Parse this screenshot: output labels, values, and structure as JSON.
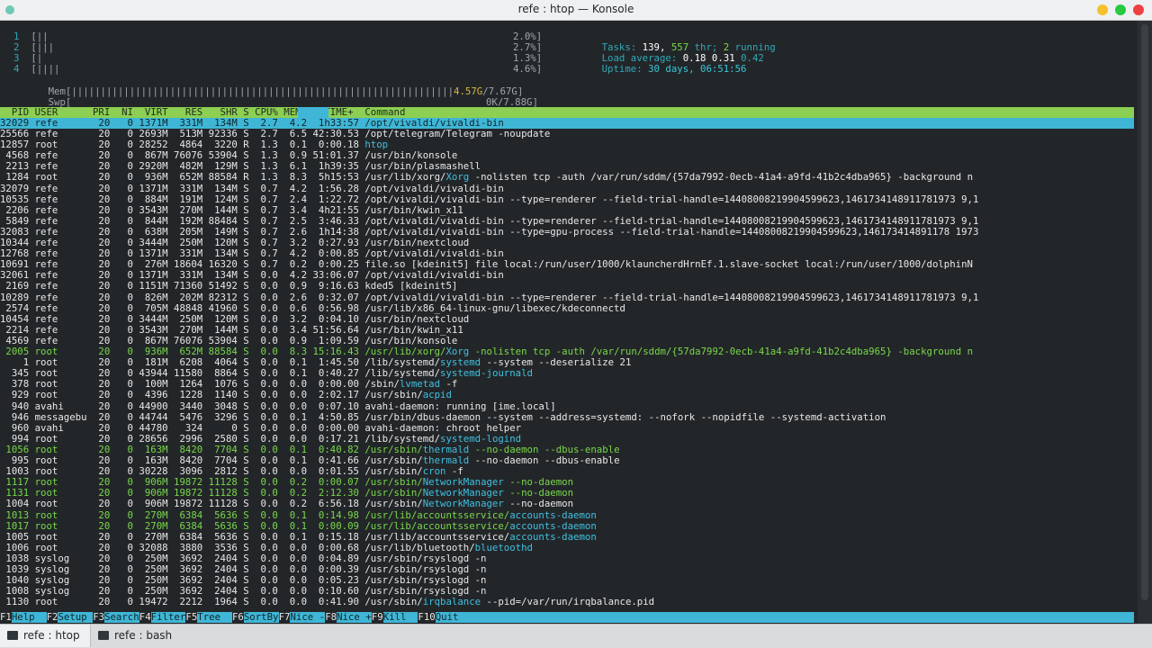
{
  "window": {
    "title": "refe : htop — Konsole",
    "buttons": {
      "minimize_color": "#f6c02c",
      "maximize_color": "#27c93f",
      "close_color": "#ee4040"
    }
  },
  "meters": {
    "cpu": [
      {
        "id": "1",
        "bar": "[||",
        "value": "2.0%]"
      },
      {
        "id": "2",
        "bar": "[|||",
        "value": "2.7%]"
      },
      {
        "id": "3",
        "bar": "[|",
        "value": "1.3%]"
      },
      {
        "id": "4",
        "bar": "[||||",
        "value": "4.6%]"
      }
    ],
    "mem": {
      "label": "Mem",
      "bar": "[||||||||||||||||||||||||||||||||||||||||||||||||||||||||||||||||||",
      "used": "4.57G",
      "total": "/7.67G]"
    },
    "swp": {
      "label": "Swp",
      "bar": "[",
      "value": "0K/7.88G]"
    }
  },
  "summary": {
    "tasks_label": "Tasks:",
    "tasks": "139,",
    "thr": "557",
    "thr_label": "thr;",
    "running": "2",
    "running_label": "running",
    "load_label": "Load average:",
    "load1": "0.18",
    "load5": "0.31",
    "load15": "0.42",
    "uptime_label": "Uptime:",
    "uptime": "30 days, 06:51:56"
  },
  "table": {
    "header": "  PID USER      PRI  NI  VIRT   RES   SHR S CPU% MEM%   TIME+  Command",
    "selected": "32029 refe       20   0 1371M  331M  134M S  2.7  4.2  1h33:57 /opt/vivaldi/vivaldi-bin",
    "rows": [
      {
        "c": "25566 refe       20   0 2693M  513M 92336 S  2.7  6.5 42:30.53 /opt/telegram/Telegram -noupdate"
      },
      {
        "c": "12857 root       20   0 28252  4864  3220 R  1.3  0.1  0:00.18 ",
        "hi": "htop"
      },
      {
        "c": " 4568 refe       20   0  867M 76076 53904 S  1.3  0.9 51:01.37 /usr/bin/konsole"
      },
      {
        "c": " 2213 refe       20   0 2920M  482M  129M S  1.3  6.1  1h39:35 /usr/bin/plasmashell"
      },
      {
        "c": " 1284 root       20   0  936M  652M 88584 R  1.3  8.3  5h15:53 /usr/lib/xorg/",
        "hi": "Xorg",
        "rest": " -nolisten tcp -auth /var/run/sddm/{57da7992-0ecb-41a4-a9fd-41b2c4dba965} -background n"
      },
      {
        "c": "32079 refe       20   0 1371M  331M  134M S  0.7  4.2  1:56.28 /opt/vivaldi/vivaldi-bin"
      },
      {
        "c": "10535 refe       20   0  884M  191M  124M S  0.7  2.4  1:22.72 /opt/vivaldi/vivaldi-bin --type=renderer --field-trial-handle=14408008219904599623,1461734148911781973 9,1"
      },
      {
        "c": " 2206 refe       20   0 3543M  270M  144M S  0.7  3.4  4h21:55 /usr/bin/kwin_x11"
      },
      {
        "c": " 5849 refe       20   0  844M  192M 88484 S  0.7  2.5  3:46.33 /opt/vivaldi/vivaldi-bin --type=renderer --field-trial-handle=14408008219904599623,1461734148911781973 9,1"
      },
      {
        "c": "32083 refe       20   0  638M  205M  149M S  0.7  2.6  1h14:38 /opt/vivaldi/vivaldi-bin --type=gpu-process --field-trial-handle=14408008219904599623,146173414891178 1973"
      },
      {
        "c": "10344 refe       20   0 3444M  250M  120M S  0.7  3.2  0:27.93 /usr/bin/nextcloud"
      },
      {
        "c": "12768 refe       20   0 1371M  331M  134M S  0.7  4.2  0:00.85 /opt/vivaldi/vivaldi-bin"
      },
      {
        "c": "10691 refe       20   0  276M 18604 16320 S  0.7  0.2  0:00.25 file.so [kdeinit5] file local:/run/user/1000/klauncherdHrnEf.1.slave-socket local:/run/user/1000/dolphinN"
      },
      {
        "c": "32061 refe       20   0 1371M  331M  134M S  0.0  4.2 33:06.07 /opt/vivaldi/vivaldi-bin"
      },
      {
        "c": " 2169 refe       20   0 1151M 71360 51492 S  0.0  0.9  9:16.63 kded5 [kdeinit5]"
      },
      {
        "c": "10289 refe       20   0  826M  202M 82312 S  0.0  2.6  0:32.07 /opt/vivaldi/vivaldi-bin --type=renderer --field-trial-handle=14408008219904599623,1461734148911781973 9,1"
      },
      {
        "c": " 2574 refe       20   0  705M 48848 41960 S  0.0  0.6  0:56.98 /usr/lib/x86_64-linux-gnu/libexec/kdeconnectd"
      },
      {
        "c": "10454 refe       20   0 3444M  250M  120M S  0.0  3.2  0:04.10 /usr/bin/nextcloud"
      },
      {
        "c": " 2214 refe       20   0 3543M  270M  144M S  0.0  3.4 51:56.64 /usr/bin/kwin_x11"
      },
      {
        "c": " 4569 refe       20   0  867M 76076 53904 S  0.0  0.9  1:09.59 /usr/bin/konsole"
      },
      {
        "c": " 2005 root       20   0  936M  652M 88584 S  0.0  8.3 15:16.43 /usr/lib/xorg/",
        "hi": "Xorg",
        "rest": " -nolisten tcp -auth /var/run/sddm/{57da7992-0ecb-41a4-a9fd-41b2c4dba965} -background n",
        "thread": true
      },
      {
        "c": "    1 root       20   0  181M  6208  4064 S  0.0  0.1  1:45.50 /lib/systemd/",
        "hi": "systemd",
        "rest": " --system --deserialize 21"
      },
      {
        "c": "  345 root       20   0 43944 11580  8864 S  0.0  0.1  0:40.27 /lib/systemd/",
        "hi": "systemd-journald"
      },
      {
        "c": "  378 root       20   0  100M  1264  1076 S  0.0  0.0  0:00.00 /sbin/",
        "hi": "lvmetad",
        "rest": " -f"
      },
      {
        "c": "  929 root       20   0  4396  1228  1140 S  0.0  0.0  2:02.17 /usr/sbin/",
        "hi": "acpid"
      },
      {
        "c": "  940 avahi      20   0 44900  3440  3048 S  0.0  0.0  0:07.10 avahi-daemon: running [ime.local]"
      },
      {
        "c": "  946 messagebu  20   0 44744  5476  3296 S  0.0  0.1  4:50.85 /usr/bin/dbus-daemon --system --address=systemd: --nofork --nopidfile --systemd-activation"
      },
      {
        "c": "  960 avahi      20   0 44780   324     0 S  0.0  0.0  0:00.00 avahi-daemon: chroot helper"
      },
      {
        "c": "  994 root       20   0 28656  2996  2580 S  0.0  0.0  0:17.21 /lib/systemd/",
        "hi": "systemd-logind"
      },
      {
        "c": " 1056 root       20   0  163M  8420  7704 S  0.0  0.1  0:40.82 /usr/sbin/",
        "hi": "thermald",
        "rest": " --no-daemon --dbus-enable",
        "thread": true
      },
      {
        "c": "  995 root       20   0  163M  8420  7704 S  0.0  0.1  0:41.66 /usr/sbin/",
        "hi": "thermald",
        "rest": " --no-daemon --dbus-enable"
      },
      {
        "c": " 1003 root       20   0 30228  3096  2812 S  0.0  0.0  0:01.55 /usr/sbin/",
        "hi": "cron",
        "rest": " -f"
      },
      {
        "c": " 1117 root       20   0  906M 19872 11128 S  0.0  0.2  0:00.07 /usr/sbin/",
        "hi": "NetworkManager",
        "rest": " --no-daemon",
        "thread": true
      },
      {
        "c": " 1131 root       20   0  906M 19872 11128 S  0.0  0.2  2:12.30 /usr/sbin/",
        "hi": "NetworkManager",
        "rest": " --no-daemon",
        "thread": true
      },
      {
        "c": " 1004 root       20   0  906M 19872 11128 S  0.0  0.2  6:56.18 /usr/sbin/",
        "hi": "NetworkManager",
        "rest": " --no-daemon"
      },
      {
        "c": " 1013 root       20   0  270M  6384  5636 S  0.0  0.1  0:14.98 /usr/lib/accountsservice/",
        "hi": "accounts-daemon",
        "thread": true
      },
      {
        "c": " 1017 root       20   0  270M  6384  5636 S  0.0  0.1  0:00.09 /usr/lib/accountsservice/",
        "hi": "accounts-daemon",
        "thread": true
      },
      {
        "c": " 1005 root       20   0  270M  6384  5636 S  0.0  0.1  0:15.18 /usr/lib/accountsservice/",
        "hi": "accounts-daemon"
      },
      {
        "c": " 1006 root       20   0 32088  3880  3536 S  0.0  0.0  0:00.68 /usr/lib/bluetooth/",
        "hi": "bluetoothd"
      },
      {
        "c": " 1038 syslog     20   0  250M  3692  2404 S  0.0  0.0  0:04.89 /usr/sbin/rsyslogd -n"
      },
      {
        "c": " 1039 syslog     20   0  250M  3692  2404 S  0.0  0.0  0:00.39 /usr/sbin/rsyslogd -n"
      },
      {
        "c": " 1040 syslog     20   0  250M  3692  2404 S  0.0  0.0  0:05.23 /usr/sbin/rsyslogd -n"
      },
      {
        "c": " 1008 syslog     20   0  250M  3692  2404 S  0.0  0.0  0:10.60 /usr/sbin/rsyslogd -n"
      },
      {
        "c": " 1130 root       20   0 19472  2212  1964 S  0.0  0.0  0:41.90 /usr/sbin/",
        "hi": "irqbalance",
        "rest": " --pid=/var/run/irqbalance.pid"
      }
    ]
  },
  "fkeys": [
    {
      "n": "F1",
      "l": "Help  "
    },
    {
      "n": "F2",
      "l": "Setup "
    },
    {
      "n": "F3",
      "l": "Search"
    },
    {
      "n": "F4",
      "l": "Filter"
    },
    {
      "n": "F5",
      "l": "Tree  "
    },
    {
      "n": "F6",
      "l": "SortBy"
    },
    {
      "n": "F7",
      "l": "Nice -"
    },
    {
      "n": "F8",
      "l": "Nice +"
    },
    {
      "n": "F9",
      "l": "Kill  "
    },
    {
      "n": "F10",
      "l": "Quit"
    }
  ],
  "tabs": [
    {
      "label": "refe : htop",
      "active": true
    },
    {
      "label": "refe : bash",
      "active": false
    }
  ]
}
